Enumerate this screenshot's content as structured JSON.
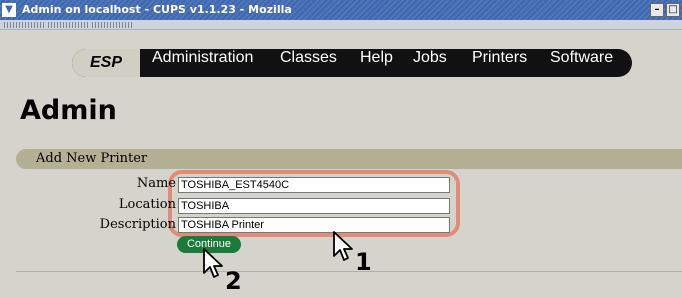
{
  "window": {
    "title": "Admin on localhost - CUPS v1.1.23 - Mozilla",
    "menu_icon": "chevron-down-icon",
    "minimize_icon": "minimize-icon",
    "maximize_icon": "maximize-icon"
  },
  "nav": {
    "esp": "ESP",
    "items": [
      "Administration",
      "Classes",
      "Help",
      "Jobs",
      "Printers",
      "Software"
    ]
  },
  "page": {
    "heading": "Admin",
    "section_title": "Add New Printer"
  },
  "form": {
    "name_label": "Name",
    "name_value": "TOSHIBA_EST4540C",
    "location_label": "Location",
    "location_value": "TOSHIBA",
    "description_label": "Description",
    "description_value": "TOSHIBA Printer",
    "continue_label": "Continue"
  },
  "annotations": {
    "step1": "1",
    "step2": "2",
    "highlight_color": "#e08c78"
  },
  "colors": {
    "titlebar": "#3d67b0",
    "nav_bg": "#111111",
    "section_bg": "#b4b094",
    "continue_bg": "#1c7a3a"
  }
}
